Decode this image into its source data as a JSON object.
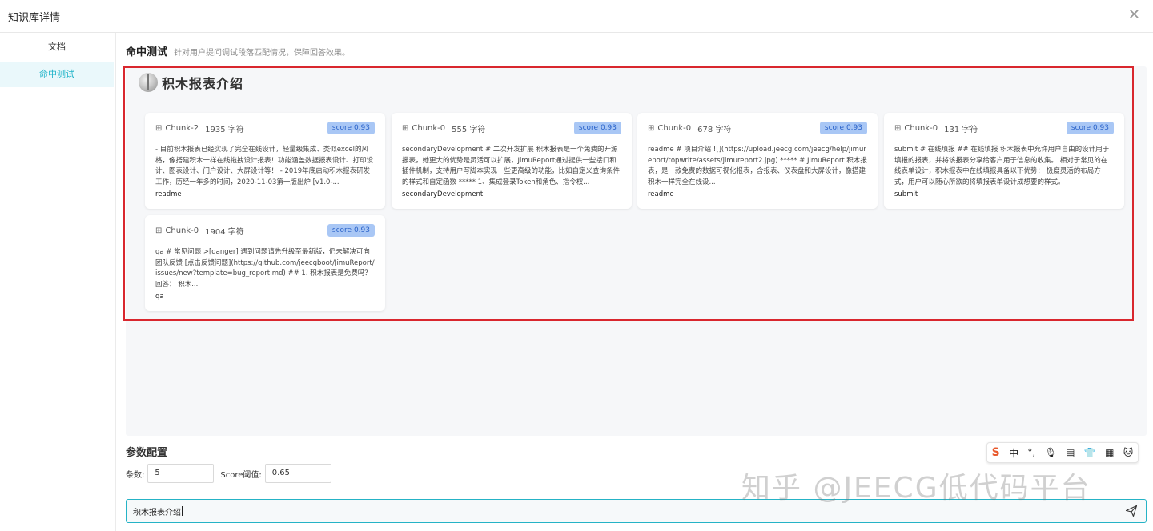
{
  "modal": {
    "title": "知识库详情",
    "close_icon": "close-icon"
  },
  "sidebar": {
    "items": [
      {
        "label": "文档"
      },
      {
        "label": "命中测试"
      }
    ]
  },
  "section": {
    "title": "命中测试",
    "description": "针对用户提问调试段落匹配情况，保障回答效果。"
  },
  "results": {
    "title": "积木报表介绍",
    "cards": [
      {
        "chunk": "Chunk-2",
        "chars": "1935 字符",
        "score": "score 0.93",
        "text": "- 目前积木报表已经实现了完全在线设计，轻量级集成、类似excel的风格，像搭建积木一样在线拖拽设计报表！功能涵盖数据报表设计、打印设计、图表设计、门户设计、大屏设计等！ - 2019年底启动积木报表研发工作，历经一年多的时间，2020-11-03第一版出炉 [v1.0-...",
        "source": "readme"
      },
      {
        "chunk": "Chunk-0",
        "chars": "555 字符",
        "score": "score 0.93",
        "text": "secondaryDevelopment # 二次开发扩展 积木报表是一个免费的开源报表，她更大的优势是灵活可以扩展，JimuReport通过提供一些接口和插件机制，支持用户写脚本实现一些更高级的功能，比如自定义查询条件的样式和自定函数 ***** 1、集成登录Token和角色、指令权...",
        "source": "secondaryDevelopment"
      },
      {
        "chunk": "Chunk-0",
        "chars": "678 字符",
        "score": "score 0.93",
        "text": "readme # 项目介绍 ![](https://upload.jeecg.com/jeecg/help/jimureport/topwrite/assets/jimureport2.jpg) ***** # JimuReport 积木报表，是一款免费的数据可视化报表，含报表、仪表盘和大屏设计，像搭建积木一样完全在线设...",
        "source": "readme"
      },
      {
        "chunk": "Chunk-0",
        "chars": "131 字符",
        "score": "score 0.93",
        "text": "submit # 在线填报 ## 在线填报 积木报表中允许用户自由的设计用于填报的报表，并将该报表分享给客户用于信息的收集。 相对于常见的在线表单设计，积木报表中在线填报具备以下优势： 极度灵活的布局方式，用户可以随心所欲的将填报表单设计成想要的样式。",
        "source": "submit"
      },
      {
        "chunk": "Chunk-0",
        "chars": "1904 字符",
        "score": "score 0.93",
        "text": "qa # 常见问题 >[danger] 遇到问题请先升级至最新版，仍未解决可向团队反馈 [点击反馈问题](https://github.com/jeecgboot/JimuReport/issues/new?template=bug_report.md) ## 1. 积木报表是免费吗？ 回答： 积木...",
        "source": "qa"
      }
    ]
  },
  "params": {
    "title": "参数配置",
    "count_label": "条数:",
    "count_value": "5",
    "score_label": "Score阈值:",
    "score_value": "0.65"
  },
  "query": {
    "value": "积木报表介绍",
    "send_icon": "send-icon"
  },
  "ime_toolbar": {
    "items": [
      "S",
      "中",
      "°,",
      "🎙",
      "▤",
      "👕",
      "▦",
      "🐱"
    ]
  },
  "watermark": "知乎 @JEECG低代码平台"
}
